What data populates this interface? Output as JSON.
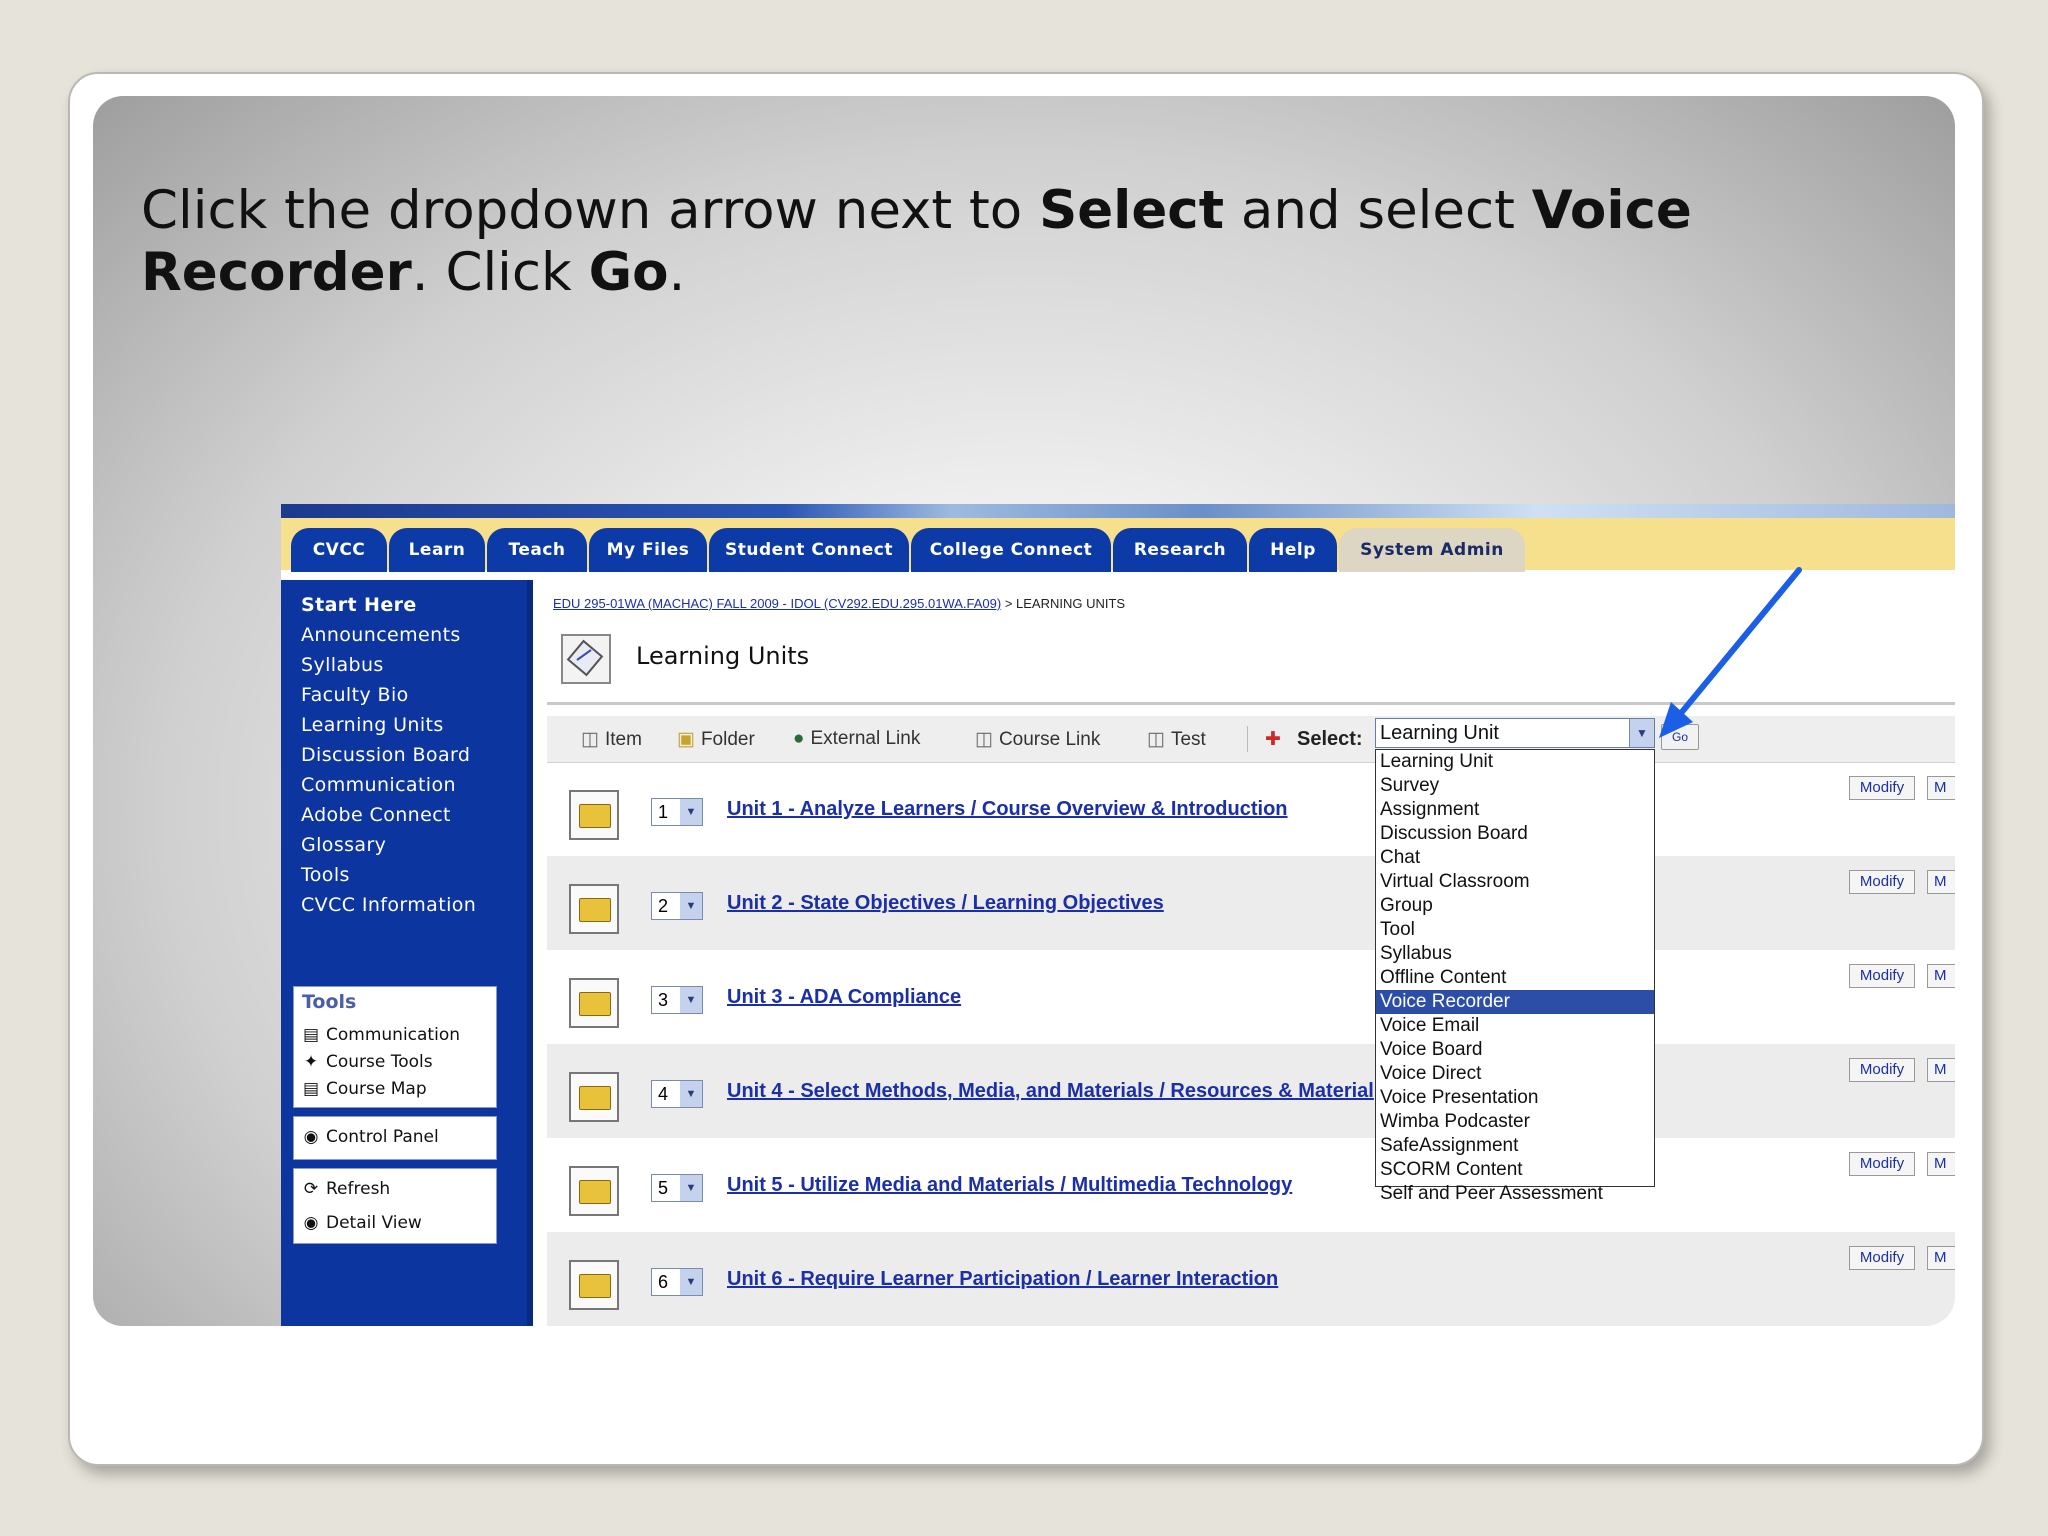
{
  "instruction": {
    "p1": "Click the dropdown arrow next to ",
    "b1": "Select",
    "p2": " and select ",
    "b2": "Voice Recorder",
    "p3": ".  Click ",
    "b3": "Go",
    "p4": "."
  },
  "tabs": [
    "CVCC",
    "Learn",
    "Teach",
    "My Files",
    "Student Connect",
    "College Connect",
    "Research",
    "Help",
    "System Admin"
  ],
  "sidebar": {
    "links": [
      "Start Here",
      "Announcements",
      "Syllabus",
      "Faculty Bio",
      "Learning Units",
      "Discussion Board",
      "Communication",
      "Adobe Connect",
      "Glossary",
      "Tools",
      "CVCC Information"
    ],
    "tools_box": {
      "title": "Tools",
      "items": [
        "Communication",
        "Course Tools",
        "Course Map"
      ]
    },
    "control_panel": "Control Panel",
    "refresh": "Refresh",
    "detail_view": "Detail View"
  },
  "breadcrumb": {
    "link": "EDU 295-01WA (MACHAC) FALL 2009 - IDOL (CV292.EDU.295.01WA.FA09)",
    "sep": " > ",
    "current": "LEARNING UNITS"
  },
  "page_title": "Learning Units",
  "actions": [
    "Item",
    "Folder",
    "External Link",
    "Course Link",
    "Test"
  ],
  "select_label": "Select:",
  "select_value": "Learning Unit",
  "go_label": "Go",
  "dropdown_options": [
    "Learning Unit",
    "Survey",
    "Assignment",
    "Discussion Board",
    "Chat",
    "Virtual Classroom",
    "Group",
    "Tool",
    "Syllabus",
    "Offline Content",
    "Voice Recorder",
    "Voice Email",
    "Voice Board",
    "Voice Direct",
    "Voice Presentation",
    "Wimba Podcaster",
    "SafeAssignment",
    "SCORM Content",
    "Self and Peer Assessment"
  ],
  "selected_option": "Voice Recorder",
  "units": [
    {
      "num": "1",
      "title": "Unit 1 - Analyze Learners / Course Overview & Introduction"
    },
    {
      "num": "2",
      "title": "Unit 2 - State Objectives / Learning Objectives"
    },
    {
      "num": "3",
      "title": "Unit 3 - ADA Compliance"
    },
    {
      "num": "4",
      "title": "Unit 4 - Select Methods, Media, and Materials / Resources & Material"
    },
    {
      "num": "5",
      "title": "Unit 5 - Utilize Media and Materials / Multimedia Technology"
    },
    {
      "num": "6",
      "title": "Unit 6 - Require Learner Participation / Learner Interaction"
    }
  ],
  "modify_label": "Modify",
  "m_label": "M",
  "colors": {
    "nav_blue": "#0c3aa6",
    "nav_yellow": "#f6e08e",
    "link_blue": "#1a2fa8",
    "highlight": "#2c4ea6",
    "arrow": "#1a5fe6"
  }
}
